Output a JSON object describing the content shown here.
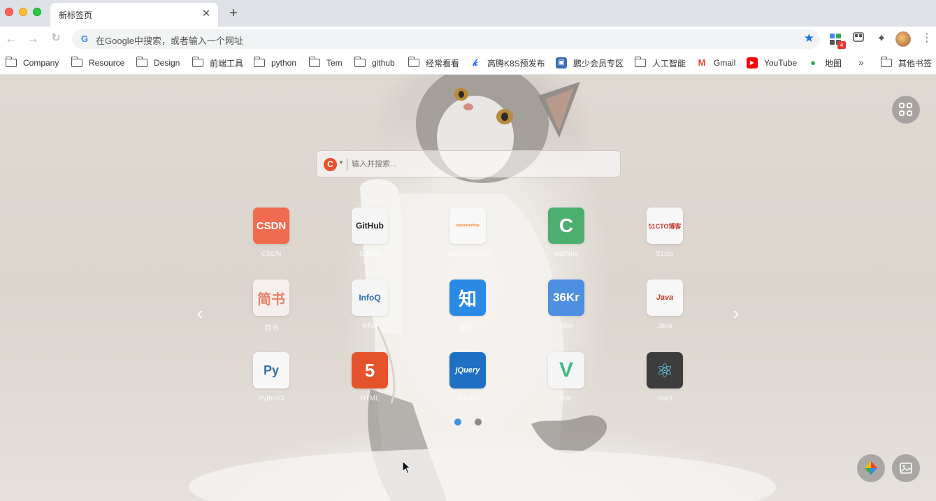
{
  "browser": {
    "tab_title": "新标签页",
    "omnibox_placeholder": "在Google中搜索，或者输入一个网址",
    "extension_badge": "4"
  },
  "bookmarks": [
    {
      "label": "Company",
      "icon": "folder-icon"
    },
    {
      "label": "Resource",
      "icon": "folder-icon"
    },
    {
      "label": "Design",
      "icon": "folder-icon"
    },
    {
      "label": "前端工具",
      "icon": "folder-icon"
    },
    {
      "label": "python",
      "icon": "folder-icon"
    },
    {
      "label": "Tem",
      "icon": "folder-icon"
    },
    {
      "label": "github",
      "icon": "folder-icon"
    },
    {
      "label": "经常看看",
      "icon": "folder-icon"
    },
    {
      "label": "高腾K8S预发布",
      "icon": "k8s-icon"
    },
    {
      "label": "鹏少会员专区",
      "icon": "member-icon"
    },
    {
      "label": "人工智能",
      "icon": "folder-icon"
    },
    {
      "label": "Gmail",
      "icon": "gmail-icon"
    },
    {
      "label": "YouTube",
      "icon": "youtube-icon"
    },
    {
      "label": "地图",
      "icon": "maps-icon"
    },
    {
      "label": "其他书签",
      "icon": "folder-icon"
    }
  ],
  "search": {
    "placeholder": "输入并搜索...",
    "engine_letter": "C"
  },
  "tiles": [
    {
      "label": "CSDN",
      "glyph": "CSDN",
      "bg": "#f26a4f",
      "fg": "#ffffff"
    },
    {
      "label": "Github",
      "glyph": "GitHub",
      "bg": "#f5f5f5",
      "fg": "#222222"
    },
    {
      "label": "stackoverflow",
      "glyph": "stackoverflow",
      "bg": "#f8f8f8",
      "fg": "#f48024"
    },
    {
      "label": "oschina",
      "glyph": "C",
      "bg": "#4caf6f",
      "fg": "#ffffff"
    },
    {
      "label": "51cto",
      "glyph": "51CTO博客",
      "bg": "#f7f7f7",
      "fg": "#c0392b"
    },
    {
      "label": "简书",
      "glyph": "简书",
      "bg": "#f5f0ee",
      "fg": "#e8826a"
    },
    {
      "label": "Infoq",
      "glyph": "InfoQ",
      "bg": "#f5f5f5",
      "fg": "#2b6cb0"
    },
    {
      "label": "知乎",
      "glyph": "知",
      "bg": "#2b8ae6",
      "fg": "#ffffff"
    },
    {
      "label": "36kr",
      "glyph": "36Kr",
      "bg": "#4d8fe0",
      "fg": "#ffffff"
    },
    {
      "label": "Java",
      "glyph": "Java",
      "bg": "#f7f7f7",
      "fg": "#c0392b"
    },
    {
      "label": "Python3",
      "glyph": "Py",
      "bg": "#f7f7f7",
      "fg": "#3572a5"
    },
    {
      "label": "HTML",
      "glyph": "5",
      "bg": "#e5532d",
      "fg": "#ffffff"
    },
    {
      "label": "JQuery",
      "glyph": "jQuery",
      "bg": "#1f6fc5",
      "fg": "#ffffff"
    },
    {
      "label": "vue",
      "glyph": "V",
      "bg": "#f5f5f5",
      "fg": "#42b883"
    },
    {
      "label": "react",
      "glyph": "⚛",
      "bg": "#3d3d3d",
      "fg": "#61dafb"
    }
  ],
  "colors": {
    "accent": "#4a90d9",
    "star": "#1a73e8"
  }
}
